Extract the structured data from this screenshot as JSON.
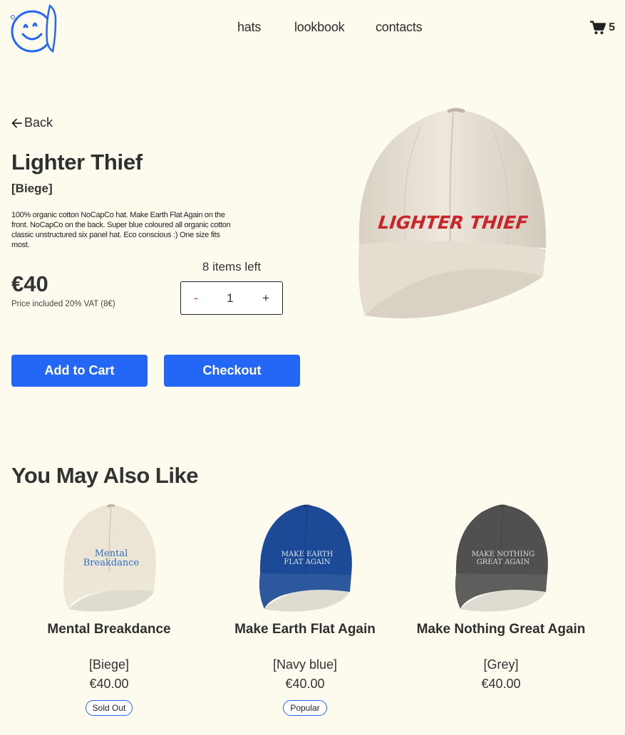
{
  "header": {
    "nav": [
      {
        "label": "hats"
      },
      {
        "label": "lookbook"
      },
      {
        "label": "contacts"
      }
    ],
    "cart_count": "5"
  },
  "colors": {
    "accent": "#2467f6",
    "background": "#fdfaee",
    "minus": "#e0332b",
    "hat_print": "#c8262a"
  },
  "product": {
    "back_label": "Back",
    "title": "Lighter Thief",
    "color": "[Biege]",
    "description": "100% organic cotton NoCapCo hat. Make Earth Flat Again on the front. NoCapCo on the back. Super blue coloured all organic cotton classic unstructured six panel hat. Eco conscious :) One size fits most.",
    "price": "€40",
    "vat_note": "Price included 20% VAT (8€)",
    "stock": "8 items left",
    "quantity": "1",
    "minus": "-",
    "plus": "+",
    "add_to_cart": "Add to Cart",
    "checkout": "Checkout",
    "hat_print": "LIGHTER THIEF"
  },
  "related": {
    "title": "You May Also Like",
    "items": [
      {
        "name": "Mental Breakdance",
        "color": "[Biege]",
        "price": "€40.00",
        "badge": "Sold Out",
        "print_line1": "Mental",
        "print_line2": "Breakdance",
        "hat_color": "#ece5d6",
        "print_color": "#2d6fc4"
      },
      {
        "name": "Make Earth Flat Again",
        "color": "[Navy blue]",
        "price": "€40.00",
        "badge": "Popular",
        "print_line1": "MAKE EARTH",
        "print_line2": "FLAT AGAIN",
        "hat_color": "#1c4a96",
        "print_color": "#dfe6f2"
      },
      {
        "name": "Make Nothing Great Again",
        "color": "[Grey]",
        "price": "€40.00",
        "badge": "",
        "print_line1": "MAKE NOTHING",
        "print_line2": "GREAT AGAIN",
        "hat_color": "#505050",
        "print_color": "#d8d8d8"
      }
    ]
  }
}
